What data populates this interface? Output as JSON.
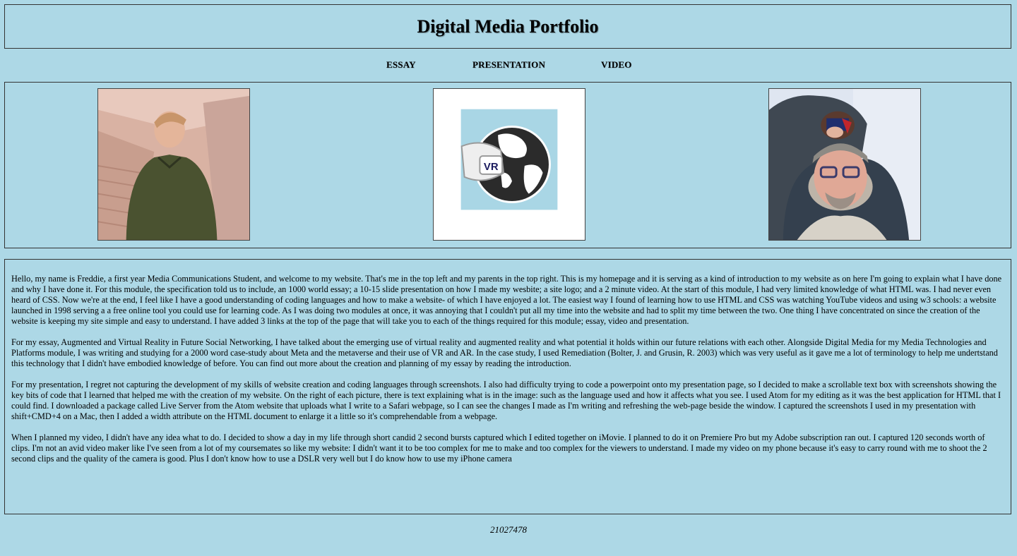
{
  "header": {
    "title": "Digital Media Portfolio"
  },
  "nav": {
    "essay": "ESSAY",
    "presentation": "PRESENTATION",
    "video": "VIDEO"
  },
  "gallery": {
    "left_alt": "photo of Freddie",
    "center_logo_text": "VR",
    "right_alt": "photo of parents"
  },
  "intro": {
    "paragraphs": [
      "Hello, my name is Freddie, a first year Media Communications Student, and welcome to my website. That's me in the top left and my parents in the top right. This is my homepage and it is serving as a kind of introduction to my website as on here I'm going to explain what I have done and why I have done it. For this module, the specification told us to include, an 1000 world essay; a 10-15 slide presentation on how I made my wesbite; a site logo; and a 2 minute video. At the start of this module, I had very limited knowledge of what HTML was. I had never even heard of CSS. Now we're at the end, I feel like I have a good understanding of coding languages and how to make a website- of which I have enjoyed a lot. The easiest way I found of learning how to use HTML and CSS was watching YouTube videos and using w3 schools: a website launched in 1998 serving a a free online tool you could use for learning code. As I was doing two modules at once, it was annoying that I couldn't put all my time into the website and had to split my time between the two. One thing I have concentrated on since the creation of the website is keeping my site simple and easy to understand. I have added 3 links at the top of the page that will take you to each of the things required for this module; essay, video and presentation.",
      "For my essay, Augmented and Virtual Reality in Future Social Networking, I have talked about the emerging use of virtual reality and augmented reality and what potential it holds within our future relations with each other. Alongside Digital Media for my Media Technologies and Platforms module, I was writing and studying for a 2000 word case-study about Meta and the metaverse and their use of VR and AR. In the case study, I used Remediation (Bolter, J. and Grusin, R. 2003) which was very useful as it gave me a lot of terminology to help me undertstand this technology that I didn't have embodied knowledge of before. You can find out more about the creation and planning of my essay by reading the introduction.",
      "For my presentation, I regret not capturing the development of my skills of website creation and coding languages through screenshots. I also had difficulty trying to code a powerpoint onto my presentation page, so I decided to make a scrollable text box with screenshots showing the key bits of code that I learned that helped me with the creation of my website. On the right of each picture, there is text explaining what is in the image: such as the language used and how it affects what you see. I used Atom for my editing as it was the best application for HTML that I could find. I downloaded a package called Live Server from the Atom website that uploads what I write to a Safari webpage, so I can see the changes I made as I'm writing and refreshing the web-page beside the window. I captured the screenshots I used in my presentation with shift+CMD+4 on a Mac, then I added a width attribute on the HTML document to enlarge it a little so it's comprehendable from a webpage.",
      "When I planned my video, I didn't have any idea what to do. I decided to show a day in my life through short candid 2 second bursts captured which I edited together on iMovie. I planned to do it on Premiere Pro but my Adobe subscription ran out. I captured 120 seconds worth of clips. I'm not an avid video maker like I've seen from a lot of my coursemates so like my website: I didn't want it to be too complex for me to make and too complex for the viewers to understand. I made my video on my phone because it's easy to carry round with me to shoot the 2 second clips and the quality of the camera is good. Plus I don't know how to use a DSLR very well but I do know how to use my iPhone camera"
    ]
  },
  "footer": {
    "id": "21027478"
  }
}
